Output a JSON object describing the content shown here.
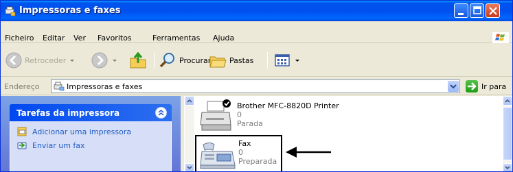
{
  "window": {
    "title": "Impressoras e faxes"
  },
  "menu": [
    "Ficheiro",
    "Editar",
    "Ver",
    "Favoritos",
    "Ferramentas",
    "Ajuda"
  ],
  "toolbar": {
    "back_label": "Retroceder",
    "search_label": "Procurar",
    "folders_label": "Pastas"
  },
  "address": {
    "label": "Endereço",
    "value": "Impressoras e faxes",
    "go_label": "Ir para"
  },
  "tasks": {
    "header": "Tarefas da impressora",
    "items": [
      "Adicionar uma impressora",
      "Enviar um fax"
    ]
  },
  "printers": [
    {
      "name": "Brother MFC-8820D Printer",
      "count": "0",
      "status": "Parada"
    },
    {
      "name": "Fax",
      "count": "0",
      "status": "Preparada"
    }
  ],
  "colors": {
    "titlebar": "#0054e3",
    "taskpane": "#7ba2e7",
    "link": "#215dc6"
  }
}
